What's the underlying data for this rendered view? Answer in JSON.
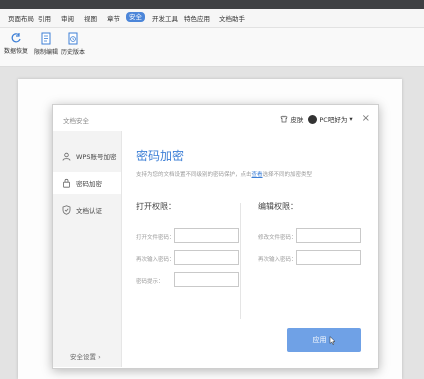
{
  "menubar": {
    "items": [
      {
        "label": "页面布局"
      },
      {
        "label": "引用"
      },
      {
        "label": "审阅"
      },
      {
        "label": "视图"
      },
      {
        "label": "章节"
      },
      {
        "label": "安全"
      },
      {
        "label": "开发工具"
      },
      {
        "label": "特色应用"
      },
      {
        "label": "文档助手"
      }
    ],
    "active_index": 5
  },
  "toolbar": {
    "items": [
      {
        "label": "数据恢复",
        "icon": "data-recovery-icon"
      },
      {
        "label": "限制编辑",
        "icon": "restrict-edit-icon"
      },
      {
        "label": "历史版本",
        "icon": "history-version-icon"
      }
    ]
  },
  "dialog": {
    "title": "文档安全",
    "header": {
      "skin_label": "皮肤",
      "user_label": "PC吧好为",
      "user_caret": "▾",
      "close": "×"
    },
    "sidebar": {
      "items": [
        {
          "label": "WPS账号加密",
          "icon": "user-icon"
        },
        {
          "label": "密码加密",
          "icon": "lock-icon"
        },
        {
          "label": "文档认证",
          "icon": "shield-check-icon"
        }
      ],
      "active_index": 1,
      "bottom_label": "安全设置",
      "bottom_caret": "›"
    },
    "main": {
      "heading": "密码加密",
      "desc_before": "支持为您的文档设置不同级别的密码保护，点击",
      "desc_link": "查看",
      "desc_after": "选择不同的加密类型",
      "open_section": {
        "title": "打开权限：",
        "fields": [
          {
            "label": "打开文件密码："
          },
          {
            "label": "再次输入密码："
          },
          {
            "label": "密码提示："
          }
        ]
      },
      "edit_section": {
        "title": "编辑权限：",
        "fields": [
          {
            "label": "修改文件密码："
          },
          {
            "label": "再次输入密码："
          }
        ]
      },
      "apply_label": "应用"
    }
  },
  "colors": {
    "accent": "#3d7fd6",
    "apply_button": "#6fa1e6",
    "active_tab": "#4c86d9",
    "topbar": "#3f4144"
  }
}
